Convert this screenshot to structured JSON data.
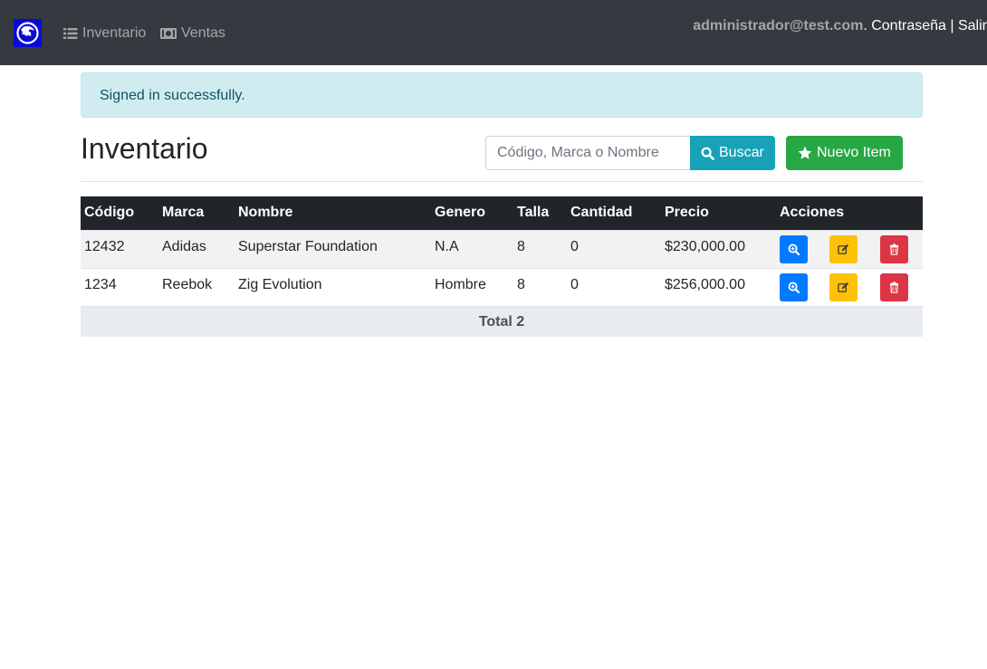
{
  "navbar": {
    "brand_icon": "lion-logo-icon",
    "links": [
      {
        "label": "Inventario",
        "icon": "list-icon"
      },
      {
        "label": "Ventas",
        "icon": "money-bill-icon"
      }
    ],
    "user_email": "administrador@test.com",
    "after_email": ". ",
    "password_link": "Contraseña",
    "separator": " | ",
    "logout_link": "Salir"
  },
  "alert": {
    "message": "Signed in successfully."
  },
  "page": {
    "title": "Inventario",
    "search_placeholder": "Código, Marca o Nombre",
    "search_button": "Buscar",
    "new_button": "Nuevo Item"
  },
  "table": {
    "headers": [
      "Código",
      "Marca",
      "Nombre",
      "Genero",
      "Talla",
      "Cantidad",
      "Precio",
      "Acciones"
    ],
    "rows": [
      {
        "codigo": "12432",
        "marca": "Adidas",
        "nombre": "Superstar Foundation",
        "genero": "N.A",
        "talla": "8",
        "cantidad": "0",
        "precio": "$230,000.00"
      },
      {
        "codigo": "1234",
        "marca": "Reebok",
        "nombre": "Zig Evolution",
        "genero": "Hombre",
        "talla": "8",
        "cantidad": "0",
        "precio": "$256,000.00"
      }
    ],
    "total": "Total 2"
  },
  "colors": {
    "navbar": "#343a40",
    "info": "#17a2b8",
    "success": "#28a745",
    "primary": "#007bff",
    "warning": "#ffc107",
    "danger": "#dc3545"
  }
}
